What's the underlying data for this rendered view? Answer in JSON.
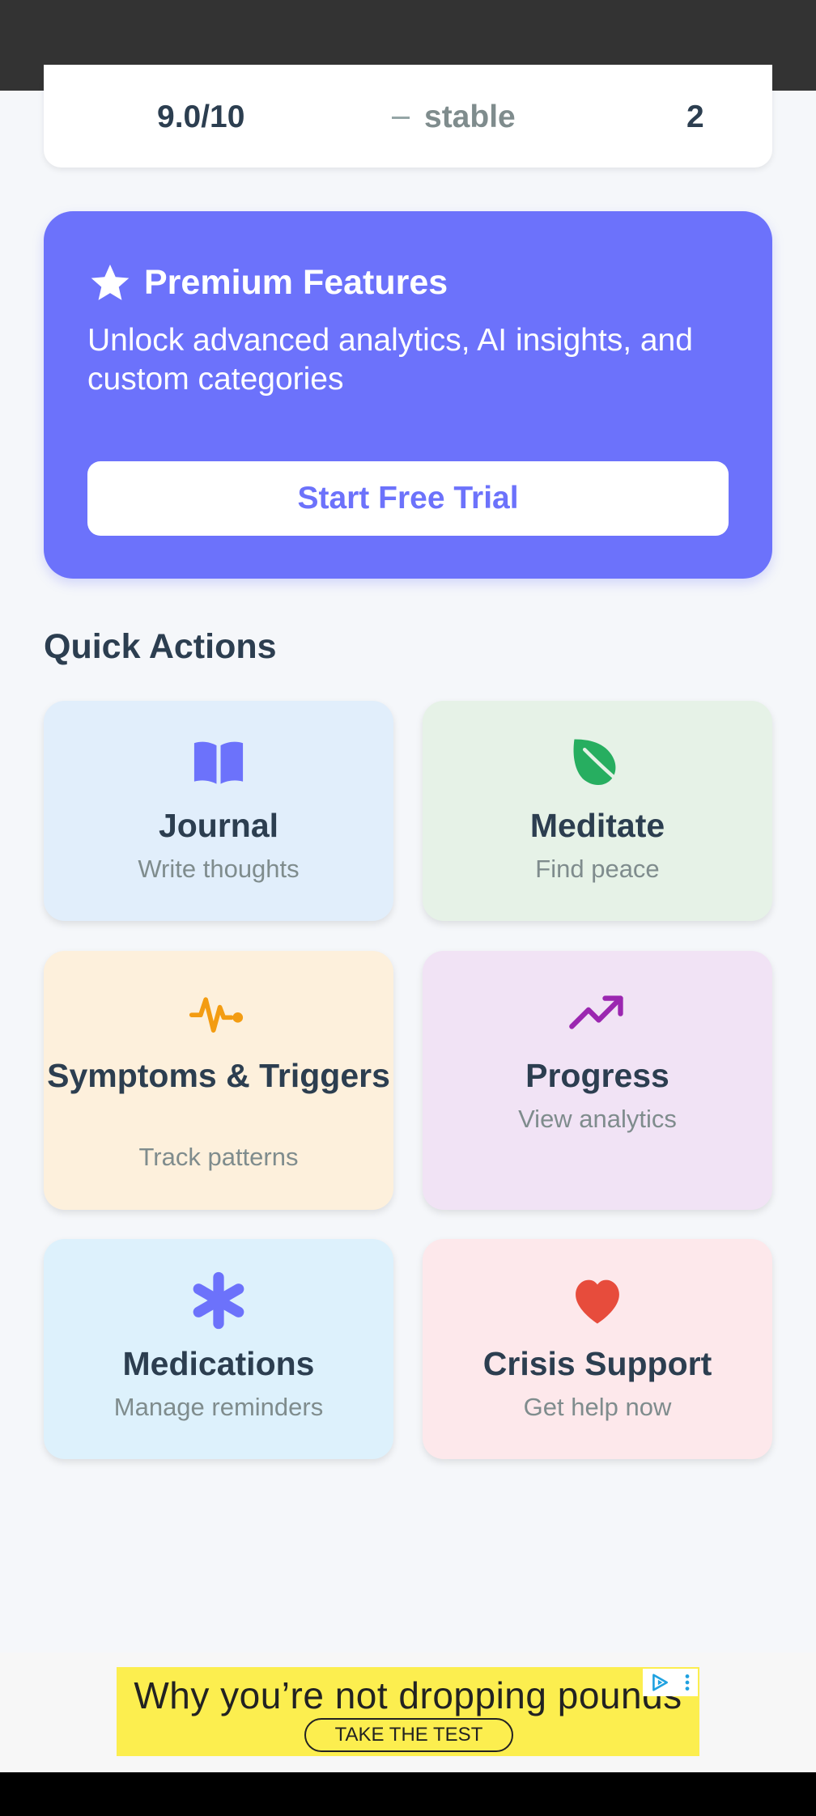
{
  "stats": {
    "score": "9.0/10",
    "trend": "stable",
    "count": "2"
  },
  "premium": {
    "title": "Premium Features",
    "subtitle": "Unlock advanced analytics, AI insights, and custom categories",
    "button_label": "Start Free Trial",
    "icon": "star-icon"
  },
  "quick_actions": {
    "title": "Quick Actions",
    "items": [
      {
        "title": "Journal",
        "subtitle": "Write thoughts",
        "icon": "book-icon",
        "color": "#6c72fb"
      },
      {
        "title": "Meditate",
        "subtitle": "Find peace",
        "icon": "leaf-icon",
        "color": "#27ae60"
      },
      {
        "title": "Symptoms & Triggers",
        "subtitle": "Track patterns",
        "icon": "pulse-icon",
        "color": "#f39c12"
      },
      {
        "title": "Progress",
        "subtitle": "View analytics",
        "icon": "trending-up-icon",
        "color": "#9b27b0"
      },
      {
        "title": "Medications",
        "subtitle": "Manage reminders",
        "icon": "asterisk-icon",
        "color": "#6c72fb"
      },
      {
        "title": "Crisis Support",
        "subtitle": "Get help now",
        "icon": "heart-icon",
        "color": "#e74c3c"
      }
    ]
  },
  "ad": {
    "headline": "Why you’re not dropping pounds",
    "cta": "TAKE THE TEST"
  },
  "colors": {
    "accent": "#6c72fb",
    "background": "#f5f7fa",
    "text": "#2c3e50",
    "muted": "#7f8c8d"
  }
}
